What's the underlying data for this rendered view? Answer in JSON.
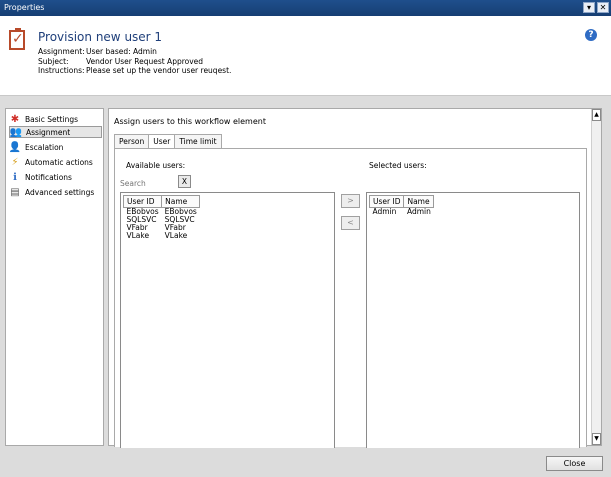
{
  "window": {
    "title": "Properties",
    "menu_glyph": "▾",
    "close_glyph": "✕"
  },
  "header": {
    "title": "Provision new user 1",
    "rows": [
      {
        "label": "Assignment:",
        "value": "User based: Admin"
      },
      {
        "label": "Subject:",
        "value": "Vendor User Request Approved"
      },
      {
        "label": "Instructions:",
        "value": "Please set up the vendor user reuqest."
      }
    ],
    "icon": "checklist-icon",
    "help_icon": "help-icon",
    "help_glyph": "?"
  },
  "nav": {
    "items": [
      {
        "label": "Basic Settings",
        "icon": "asterisk-icon",
        "glyph": "✱",
        "color": "#d0302a",
        "selected": false
      },
      {
        "label": "Assignment",
        "icon": "users-icon",
        "glyph": "👥",
        "color": "#3a6ab0",
        "selected": true
      },
      {
        "label": "Escalation",
        "icon": "escalation-icon",
        "glyph": "👤",
        "color": "#c04040",
        "selected": false
      },
      {
        "label": "Automatic actions",
        "icon": "lightning-icon",
        "glyph": "⚡",
        "color": "#d6a01e",
        "selected": false
      },
      {
        "label": "Notifications",
        "icon": "info-icon",
        "glyph": "ℹ",
        "color": "#2f6cc4",
        "selected": false
      },
      {
        "label": "Advanced settings",
        "icon": "settings-icon",
        "glyph": "▤",
        "color": "#555555",
        "selected": false
      }
    ]
  },
  "main": {
    "title": "Assign users to this workflow element",
    "tabs": [
      {
        "label": "Person",
        "active": false
      },
      {
        "label": "User",
        "active": true
      },
      {
        "label": "Time limit",
        "active": false
      }
    ],
    "available_label": "Available users:",
    "selected_label": "Selected users:",
    "search_placeholder": "Search",
    "clear_label": "X",
    "add_label": ">",
    "remove_label": "<",
    "columns": [
      "User ID",
      "Name"
    ],
    "available_users": [
      {
        "id": "EBobvos",
        "name": "EBobvos"
      },
      {
        "id": "SQLSVC",
        "name": "SQLSVC"
      },
      {
        "id": "VFabr",
        "name": "VFabr"
      },
      {
        "id": "VLake",
        "name": "VLake"
      }
    ],
    "selected_users": [
      {
        "id": "Admin",
        "name": "Admin"
      }
    ]
  },
  "footer": {
    "close_label": "Close"
  }
}
